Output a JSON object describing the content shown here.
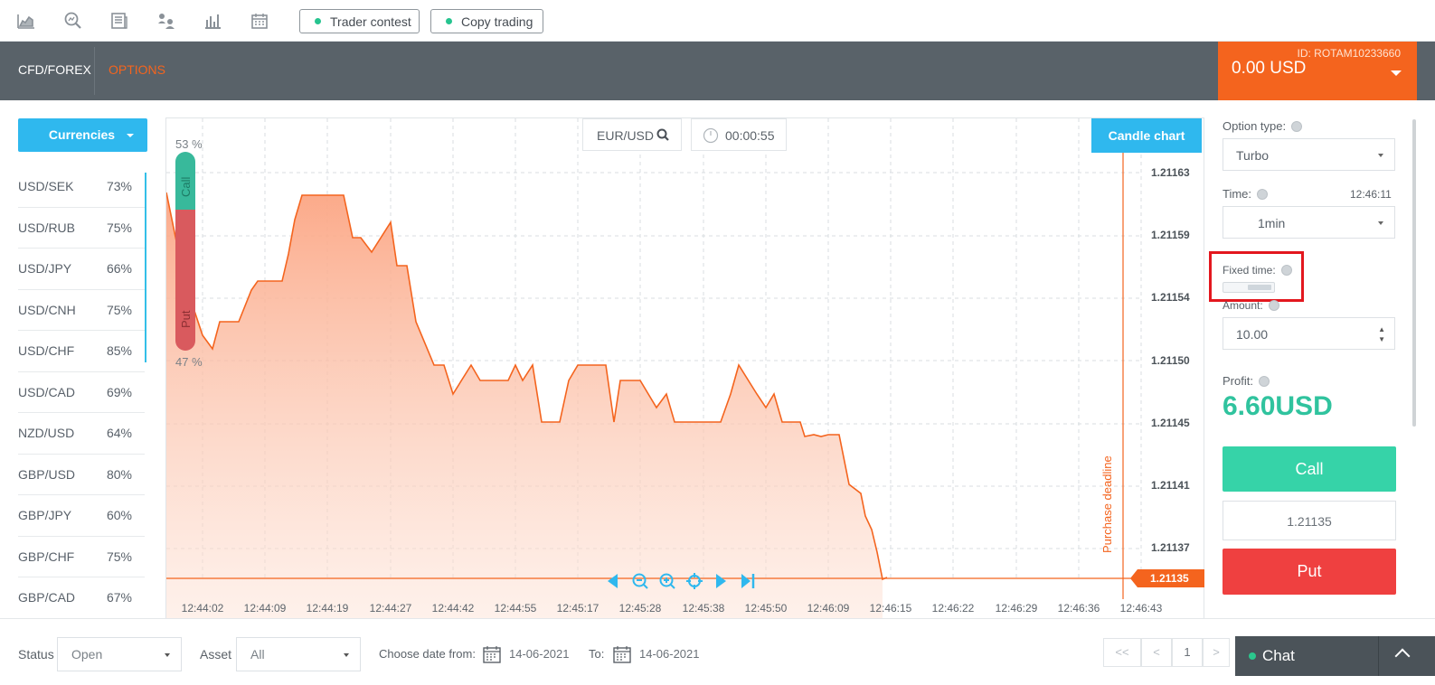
{
  "topbar": {
    "icons": [
      "area-chart-icon",
      "search-chart-icon",
      "news-icon",
      "people-icon",
      "bar-chart-icon",
      "calendar-icon"
    ],
    "trader_contest": "Trader contest",
    "copy_trading": "Copy trading"
  },
  "header": {
    "tab_cfd": "CFD/FOREX",
    "tab_options": "OPTIONS",
    "account_id": "ID: ROTAM10233660",
    "balance": "0.00 USD"
  },
  "left": {
    "currencies_label": "Currencies",
    "pairs": [
      {
        "name": "USD/SEK",
        "pct": "73%"
      },
      {
        "name": "USD/RUB",
        "pct": "75%"
      },
      {
        "name": "USD/JPY",
        "pct": "66%"
      },
      {
        "name": "USD/CNH",
        "pct": "75%"
      },
      {
        "name": "USD/CHF",
        "pct": "85%"
      },
      {
        "name": "USD/CAD",
        "pct": "69%"
      },
      {
        "name": "NZD/USD",
        "pct": "64%"
      },
      {
        "name": "GBP/USD",
        "pct": "80%"
      },
      {
        "name": "GBP/JPY",
        "pct": "60%"
      },
      {
        "name": "GBP/CHF",
        "pct": "75%"
      },
      {
        "name": "GBP/CAD",
        "pct": "67%"
      }
    ]
  },
  "chart": {
    "asset": "EUR/USD",
    "timer": "00:00:55",
    "candle_chart": "Candle chart",
    "call_pct": "53 %",
    "put_pct": "47 %",
    "call_label": "Call",
    "put_label": "Put",
    "deadline_label": "Purchase deadline",
    "current_price": "1.21135",
    "y_ticks": [
      "1.21163",
      "1.21159",
      "1.21154",
      "1.21150",
      "1.21145",
      "1.21141",
      "1.21137"
    ],
    "x_ticks": [
      "12:44:02",
      "12:44:09",
      "12:44:19",
      "12:44:27",
      "12:44:42",
      "12:44:55",
      "12:45:17",
      "12:45:28",
      "12:45:38",
      "12:45:50",
      "12:46:09",
      "12:46:15",
      "12:46:22",
      "12:46:29",
      "12:46:36",
      "12:46:43"
    ],
    "accent_color": "#f4641e",
    "fill_color": "#fbb79a"
  },
  "right": {
    "option_type_label": "Option type:",
    "option_type_value": "Turbo",
    "time_label": "Time:",
    "clock": "12:46:11",
    "time_value": "1min",
    "fixed_time_label": "Fixed time:",
    "amount_label": "Amount:",
    "amount_value": "10.00",
    "profit_label": "Profit:",
    "profit_value": "6.60USD",
    "call_button": "Call",
    "quote": "1.21135",
    "put_button": "Put"
  },
  "bottom": {
    "status_label": "Status",
    "status_value": "Open",
    "asset_label": "Asset",
    "asset_value": "All",
    "date_from_label": "Choose date from:",
    "date_from": "14-06-2021",
    "to_label": "To:",
    "date_to": "14-06-2021",
    "pager_first": "<<",
    "pager_prev": "<",
    "page": "1",
    "pager_next": ">",
    "chat_label": "Chat"
  }
}
